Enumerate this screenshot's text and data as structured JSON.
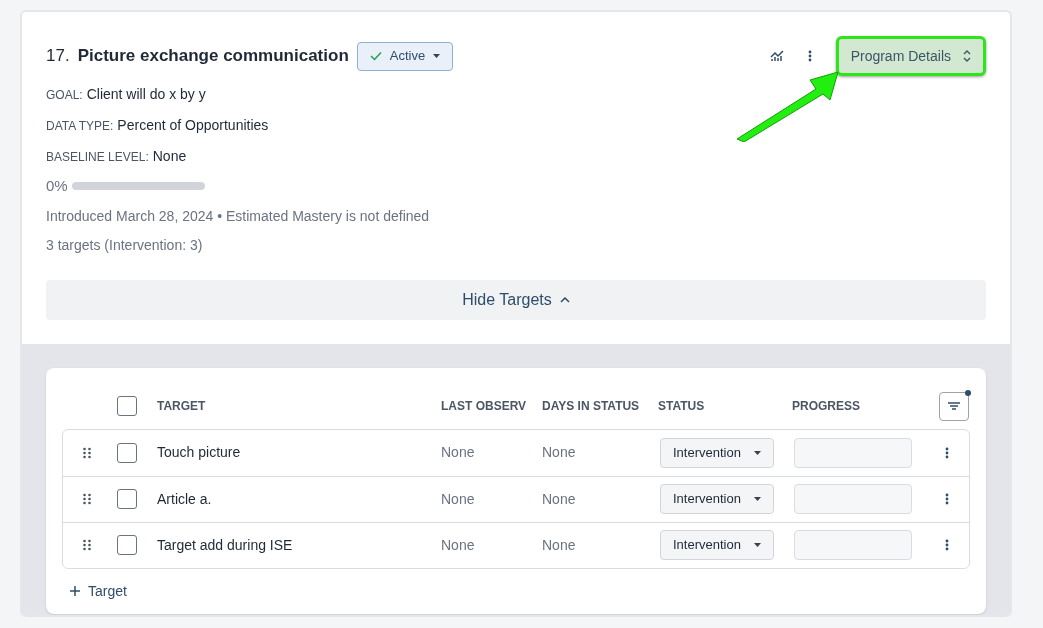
{
  "program": {
    "number": "17.",
    "title": "Picture exchange communication",
    "status": {
      "label": "Active",
      "checked": true
    },
    "goal": {
      "label": "GOAL:",
      "value": "Client will do x by y"
    },
    "data_type": {
      "label": "DATA TYPE:",
      "value": "Percent of Opportunities"
    },
    "baseline": {
      "label": "BASELINE LEVEL:",
      "value": "None"
    },
    "progress": {
      "reading": "0%",
      "level": 0
    },
    "introduced": "Introduced March 28, 2024 • Estimated Mastery is not defined",
    "targets_summary": "3 targets (Intervention: 3)",
    "details_button": "Program Details",
    "toggle_targets": "Hide Targets"
  },
  "table": {
    "columns": [
      "TARGET",
      "LAST OBSERV",
      "DAYS IN STATUS",
      "STATUS",
      "PROGRESS"
    ],
    "filter_active": true,
    "select_all_checked": false,
    "rows": [
      {
        "target": "Touch picture",
        "last_observ": "None",
        "days_in_status": "None",
        "status": "Intervention",
        "checked": false
      },
      {
        "target": "Article a.",
        "last_observ": "None",
        "days_in_status": "None",
        "status": "Intervention",
        "checked": false
      },
      {
        "target": "Target add during ISE",
        "last_observ": "None",
        "days_in_status": "None",
        "status": "Intervention",
        "checked": false
      }
    ],
    "add_button": "Target"
  }
}
